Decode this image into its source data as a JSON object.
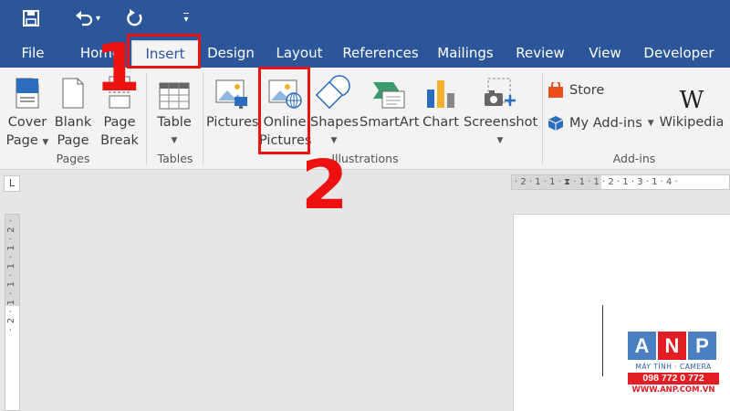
{
  "qat": {
    "undo_caret": "▾",
    "customize_caret": "▾"
  },
  "tabs": [
    {
      "label": "File"
    },
    {
      "label": "Home"
    },
    {
      "label": "Insert"
    },
    {
      "label": "Design"
    },
    {
      "label": "Layout"
    },
    {
      "label": "References"
    },
    {
      "label": "Mailings"
    },
    {
      "label": "Review"
    },
    {
      "label": "View"
    },
    {
      "label": "Developer"
    }
  ],
  "ribbon": {
    "pages": {
      "cover_line1": "Cover",
      "cover_line2": "Page",
      "blank_line1": "Blank",
      "blank_line2": "Page",
      "break_line1": "Page",
      "break_line2": "Break",
      "group": "Pages"
    },
    "tables": {
      "table": "Table",
      "group": "Tables"
    },
    "illustrations": {
      "pictures": "Pictures",
      "online_line1": "Online",
      "online_line2": "Pictures",
      "shapes": "Shapes",
      "smartart": "SmartArt",
      "chart": "Chart",
      "screenshot": "Screenshot",
      "group": "Illustrations"
    },
    "addins": {
      "store": "Store",
      "my_addins": "My Add-ins",
      "wikipedia": "Wikipedia",
      "wiki_glyph": "W",
      "group": "Add-ins"
    }
  },
  "rulers": {
    "horizontal": "· 2 · 1 · 1 · ⧗ · 1 · 1 · 2 · 1 · 3 · 1 · 4 ·",
    "vertical": "· 2 · 1 · 1 · 1 · 1 · 2 ·",
    "tab_selector": "L"
  },
  "annotations": {
    "step1": "1",
    "step2": "2",
    "color": "#e11111"
  },
  "logo": {
    "a": "A",
    "n": "N",
    "p": "P",
    "tagline": "MÁY TÍNH · CAMERA",
    "phone": "098 772 0 772",
    "web": "WWW.ANP.COM.VN"
  },
  "colors": {
    "word_blue": "#2b579a",
    "ribbon_bg": "#f3f3f3",
    "logo_blue": "#4a7fc1",
    "logo_red": "#e21d24"
  }
}
